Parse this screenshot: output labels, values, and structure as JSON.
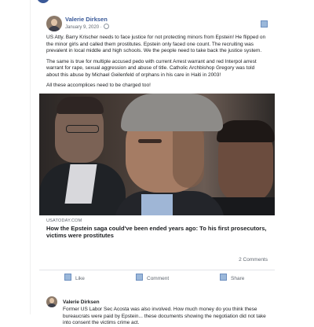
{
  "post": {
    "author": "Valerie Dirksen",
    "date": "January 9, 2020",
    "date_separator": "·",
    "paragraphs": [
      "US Atty.  Barry Krischer needs to face justice for not protecting minors from Epstein!  He flipped on the minor girls and called them prostitutes.  Epstein only faced one count.  The recruiting was prevalent in local middle and high schools.  We the people need to take back the justice system.",
      "The same is true for multiple accused pedo with current Arrest warrant and red Interpol arrest warrant for rape, sexual aggression and abuse of title.  Catholic Archbishop Gregory was told about this abuse by Michael Geilenfeld of orphans in his care in Haiti in 2003!",
      "All these accomplices need to be charged too!"
    ]
  },
  "link_preview": {
    "source": "USATODAY.COM",
    "title": "How the Epstein saga could've been ended years ago: To his first prosecutors, victims were prostitutes"
  },
  "engagement": {
    "comments_count": "2 Comments"
  },
  "actions": {
    "like": "Like",
    "comment": "Comment",
    "share": "Share"
  },
  "comment": {
    "author": "Valerie Dirksen",
    "text": "Former US Labor Sec Acosta was also involved. How much money do you think these bureaucrats were paid by Epstein... these documents showing the negotiation did not take into consent the victims crime act."
  },
  "icons": {
    "privacy": "globe-icon",
    "menu": "more-options-icon",
    "like": "like-icon",
    "comment": "comment-icon",
    "share": "share-icon"
  },
  "colors": {
    "brand": "#3b5998",
    "name_link": "#385898",
    "secondary_text": "#606770",
    "icon_fill": "#9bb8da"
  }
}
